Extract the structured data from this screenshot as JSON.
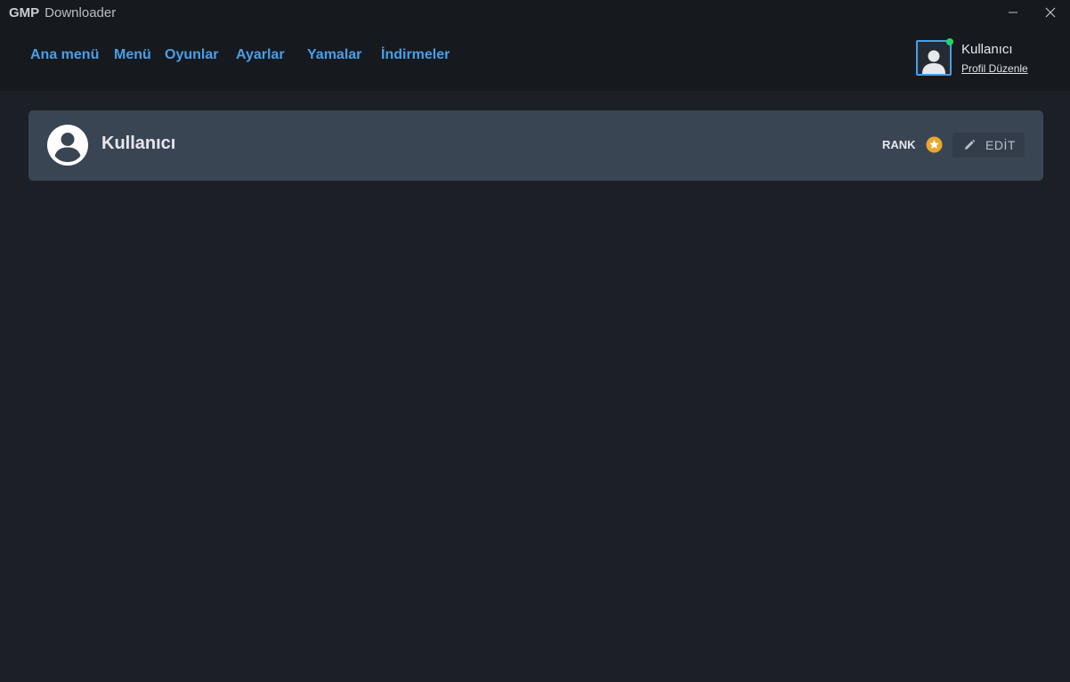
{
  "window": {
    "title_bold": "GMP",
    "title_rest": "Downloader",
    "minimize_icon": "minimize-icon",
    "close_icon": "close-icon"
  },
  "nav": {
    "items": [
      {
        "label": "Ana menü"
      },
      {
        "label": "Menü"
      },
      {
        "label": "Oyunlar"
      },
      {
        "label": "Ayarlar"
      },
      {
        "label": "Yamalar"
      },
      {
        "label": "İndirmeler"
      }
    ]
  },
  "user": {
    "name": "Kullanıcı",
    "edit_profile_link": "Profil Düzenle",
    "status": "online"
  },
  "profile_card": {
    "name": "Kullanıcı",
    "rank_label": "RANK",
    "rank_icon": "star-badge-icon",
    "edit_button_label": "EDİT"
  },
  "colors": {
    "accent": "#4a9fe6",
    "background": "#1c1f26",
    "header": "#16191e",
    "card": "#3a4554",
    "online": "#25d36b",
    "rank_gold": "#e8a82e"
  }
}
